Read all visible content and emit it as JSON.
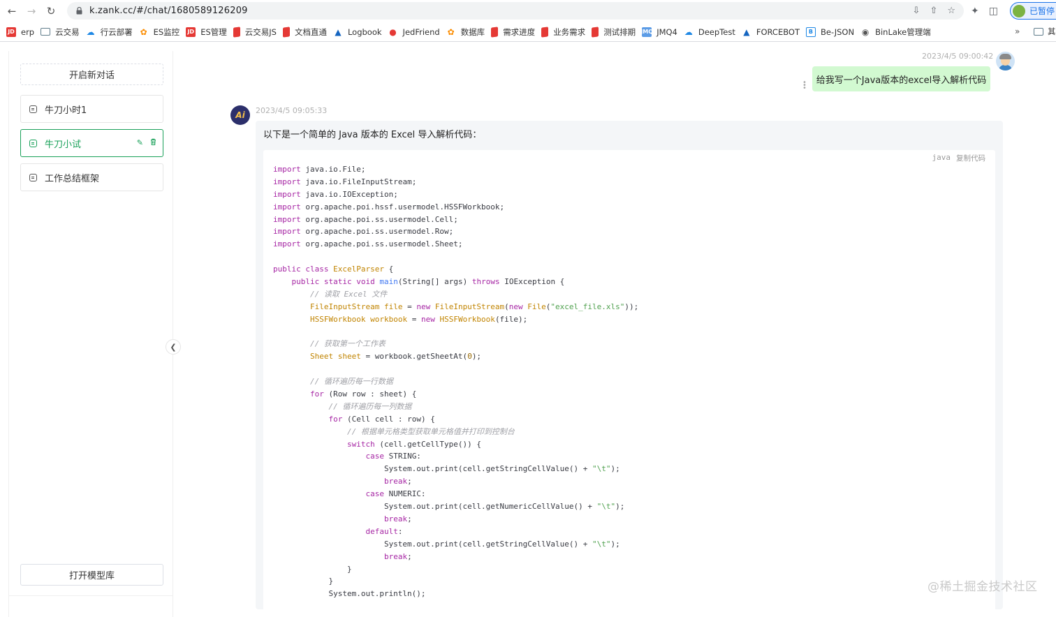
{
  "browser": {
    "url": "k.zank.cc/#/chat/1680589126209",
    "profile_status": "已暂停",
    "bookmarks": [
      {
        "label": "erp",
        "color": "#e53935",
        "glyph": "JD"
      },
      {
        "label": "云交易",
        "color": "#607d8b",
        "glyph": "folder"
      },
      {
        "label": "行云部署",
        "color": "#1e88e5",
        "glyph": "cloud"
      },
      {
        "label": "ES监控",
        "color": "#fb8c00",
        "glyph": "swirl"
      },
      {
        "label": "ES管理",
        "color": "#e53935",
        "glyph": "JD"
      },
      {
        "label": "云交易JS",
        "color": "#e53935",
        "glyph": "page"
      },
      {
        "label": "文档直通",
        "color": "#e53935",
        "glyph": "page"
      },
      {
        "label": "Logbook",
        "color": "#1565c0",
        "glyph": "mountain"
      },
      {
        "label": "JedFriend",
        "color": "#e53935",
        "glyph": "drop"
      },
      {
        "label": "数据库",
        "color": "#fb8c00",
        "glyph": "swirl"
      },
      {
        "label": "需求进度",
        "color": "#e53935",
        "glyph": "page"
      },
      {
        "label": "业务需求",
        "color": "#e53935",
        "glyph": "page"
      },
      {
        "label": "测试排期",
        "color": "#e53935",
        "glyph": "page"
      },
      {
        "label": "JMQ4",
        "color": "#5c9ce6",
        "glyph": "JMQ"
      },
      {
        "label": "DeepTest",
        "color": "#1e88e5",
        "glyph": "cloud"
      },
      {
        "label": "FORCEBOT",
        "color": "#1565c0",
        "glyph": "mountain"
      },
      {
        "label": "Be-JSON",
        "color": "#1e88e5",
        "glyph": "B"
      },
      {
        "label": "BinLake管理端",
        "color": "#555555",
        "glyph": "globe"
      }
    ],
    "more_bookmarks": "»",
    "other_folder": "其"
  },
  "sidebar": {
    "new_chat": "开启新对话",
    "conversations": [
      {
        "label": "牛刀小时1",
        "active": false
      },
      {
        "label": "牛刀小试",
        "active": true
      },
      {
        "label": "工作总结框架",
        "active": false
      }
    ],
    "model_library": "打开模型库"
  },
  "chat": {
    "user": {
      "time": "2023/4/5 09:00:42",
      "message": "给我写一个Java版本的excel导入解析代码"
    },
    "ai": {
      "avatar_text": "Ai",
      "time": "2023/4/5 09:05:33",
      "intro": "以下是一个简单的 Java 版本的 Excel 导入解析代码：",
      "code_lang": "java",
      "copy_label": "复制代码",
      "code_lines": [
        [
          [
            "k",
            "import"
          ],
          [
            "p",
            " java.io.File;"
          ]
        ],
        [
          [
            "k",
            "import"
          ],
          [
            "p",
            " java.io.FileInputStream;"
          ]
        ],
        [
          [
            "k",
            "import"
          ],
          [
            "p",
            " java.io.IOException;"
          ]
        ],
        [
          [
            "k",
            "import"
          ],
          [
            "p",
            " org.apache.poi.hssf.usermodel.HSSFWorkbook;"
          ]
        ],
        [
          [
            "k",
            "import"
          ],
          [
            "p",
            " org.apache.poi.ss.usermodel.Cell;"
          ]
        ],
        [
          [
            "k",
            "import"
          ],
          [
            "p",
            " org.apache.poi.ss.usermodel.Row;"
          ]
        ],
        [
          [
            "k",
            "import"
          ],
          [
            "p",
            " org.apache.poi.ss.usermodel.Sheet;"
          ]
        ],
        [],
        [
          [
            "k",
            "public"
          ],
          [
            "p",
            " "
          ],
          [
            "k",
            "class"
          ],
          [
            "p",
            " "
          ],
          [
            "t",
            "ExcelParser"
          ],
          [
            "p",
            " {"
          ]
        ],
        [
          [
            "p",
            "    "
          ],
          [
            "k",
            "public"
          ],
          [
            "p",
            " "
          ],
          [
            "k",
            "static"
          ],
          [
            "p",
            " "
          ],
          [
            "k",
            "void"
          ],
          [
            "p",
            " "
          ],
          [
            "f",
            "main"
          ],
          [
            "p",
            "(String[] args) "
          ],
          [
            "k",
            "throws"
          ],
          [
            "p",
            " IOException {"
          ]
        ],
        [
          [
            "p",
            "        "
          ],
          [
            "c",
            "// 读取 Excel 文件"
          ]
        ],
        [
          [
            "p",
            "        "
          ],
          [
            "t",
            "FileInputStream"
          ],
          [
            "p",
            " "
          ],
          [
            "t",
            "file"
          ],
          [
            "p",
            " = "
          ],
          [
            "k",
            "new"
          ],
          [
            "p",
            " "
          ],
          [
            "t",
            "FileInputStream"
          ],
          [
            "p",
            "("
          ],
          [
            "k",
            "new"
          ],
          [
            "p",
            " "
          ],
          [
            "t",
            "File"
          ],
          [
            "p",
            "("
          ],
          [
            "s",
            "\"excel_file.xls\""
          ],
          [
            "p",
            "));"
          ]
        ],
        [
          [
            "p",
            "        "
          ],
          [
            "t",
            "HSSFWorkbook"
          ],
          [
            "p",
            " "
          ],
          [
            "t",
            "workbook"
          ],
          [
            "p",
            " = "
          ],
          [
            "k",
            "new"
          ],
          [
            "p",
            " "
          ],
          [
            "t",
            "HSSFWorkbook"
          ],
          [
            "p",
            "(file);"
          ]
        ],
        [],
        [
          [
            "p",
            "        "
          ],
          [
            "c",
            "// 获取第一个工作表"
          ]
        ],
        [
          [
            "p",
            "        "
          ],
          [
            "t",
            "Sheet"
          ],
          [
            "p",
            " "
          ],
          [
            "t",
            "sheet"
          ],
          [
            "p",
            " = workbook.getSheetAt("
          ],
          [
            "n",
            "0"
          ],
          [
            "p",
            ");"
          ]
        ],
        [],
        [
          [
            "p",
            "        "
          ],
          [
            "c",
            "// 循环遍历每一行数据"
          ]
        ],
        [
          [
            "p",
            "        "
          ],
          [
            "k",
            "for"
          ],
          [
            "p",
            " (Row row : sheet) {"
          ]
        ],
        [
          [
            "p",
            "            "
          ],
          [
            "c",
            "// 循环遍历每一列数据"
          ]
        ],
        [
          [
            "p",
            "            "
          ],
          [
            "k",
            "for"
          ],
          [
            "p",
            " (Cell cell : row) {"
          ]
        ],
        [
          [
            "p",
            "                "
          ],
          [
            "c",
            "// 根据单元格类型获取单元格值并打印到控制台"
          ]
        ],
        [
          [
            "p",
            "                "
          ],
          [
            "k",
            "switch"
          ],
          [
            "p",
            " (cell.getCellType()) {"
          ]
        ],
        [
          [
            "p",
            "                    "
          ],
          [
            "k",
            "case"
          ],
          [
            "p",
            " STRING:"
          ]
        ],
        [
          [
            "p",
            "                        System.out.print(cell.getStringCellValue() + "
          ],
          [
            "s",
            "\"\\t\""
          ],
          [
            "p",
            ");"
          ]
        ],
        [
          [
            "p",
            "                        "
          ],
          [
            "k",
            "break"
          ],
          [
            "p",
            ";"
          ]
        ],
        [
          [
            "p",
            "                    "
          ],
          [
            "k",
            "case"
          ],
          [
            "p",
            " NUMERIC:"
          ]
        ],
        [
          [
            "p",
            "                        System.out.print(cell.getNumericCellValue() + "
          ],
          [
            "s",
            "\"\\t\""
          ],
          [
            "p",
            ");"
          ]
        ],
        [
          [
            "p",
            "                        "
          ],
          [
            "k",
            "break"
          ],
          [
            "p",
            ";"
          ]
        ],
        [
          [
            "p",
            "                    "
          ],
          [
            "k",
            "default"
          ],
          [
            "p",
            ":"
          ]
        ],
        [
          [
            "p",
            "                        System.out.print(cell.getStringCellValue() + "
          ],
          [
            "s",
            "\"\\t\""
          ],
          [
            "p",
            ");"
          ]
        ],
        [
          [
            "p",
            "                        "
          ],
          [
            "k",
            "break"
          ],
          [
            "p",
            ";"
          ]
        ],
        [
          [
            "p",
            "                }"
          ]
        ],
        [
          [
            "p",
            "            }"
          ]
        ],
        [
          [
            "p",
            "            System.out.println();"
          ]
        ]
      ]
    }
  },
  "watermark": "@稀土掘金技术社区"
}
